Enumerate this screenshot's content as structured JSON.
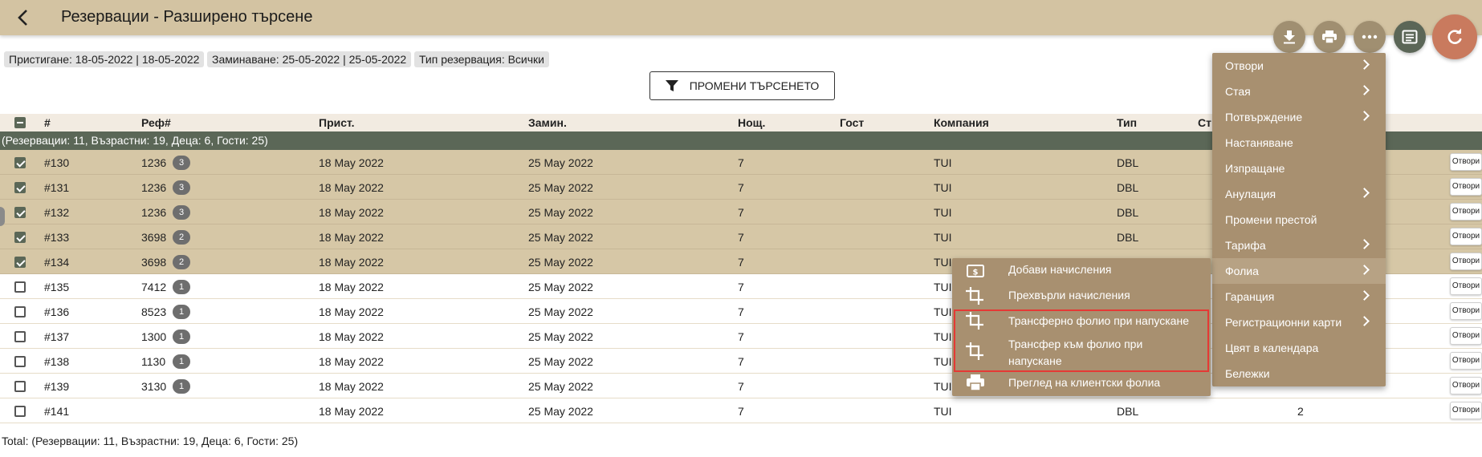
{
  "header": {
    "title": "Резервации - Разширено търсене",
    "back_icon": "chevron-left-icon",
    "actions": [
      "download-icon",
      "print-icon",
      "more-horiz-icon",
      "list-view-icon",
      "refresh-icon"
    ],
    "colors": {
      "header_bg": "#d3c3a2",
      "menu_bg": "#a89070",
      "summary_bg": "#5b6757",
      "refresh_fab": "#c97a5e"
    }
  },
  "filters": {
    "arrival": "Пристигане: 18-05-2022 | 18-05-2022",
    "departure": "Заминаване: 25-05-2022 | 25-05-2022",
    "type": "Тип резервация: Всички"
  },
  "search_button": {
    "label": "ПРОМЕНИ ТЪРСЕНЕТО",
    "icon": "filter-icon"
  },
  "table": {
    "columns": {
      "num": "#",
      "ref": "Реф#",
      "arrival": "Прист.",
      "departure": "Замин.",
      "nights": "Нощ.",
      "guest": "Гост",
      "company": "Компания",
      "type": "Тип",
      "status": "Ст"
    },
    "summary": "(Резервации: 11, Възрастни: 19, Деца: 6, Гости: 25)",
    "open_label": "Отвори",
    "rows": [
      {
        "num": "#130",
        "ref": "1236",
        "badge": "3",
        "arrival": "18 May 2022",
        "departure": "25 May 2022",
        "nights": "7",
        "company": "TUI",
        "type": "DBL",
        "last": "",
        "selected": true
      },
      {
        "num": "#131",
        "ref": "1236",
        "badge": "3",
        "arrival": "18 May 2022",
        "departure": "25 May 2022",
        "nights": "7",
        "company": "TUI",
        "type": "DBL",
        "last": "",
        "selected": true
      },
      {
        "num": "#132",
        "ref": "1236",
        "badge": "3",
        "arrival": "18 May 2022",
        "departure": "25 May 2022",
        "nights": "7",
        "company": "TUI",
        "type": "DBL",
        "last": "",
        "selected": true
      },
      {
        "num": "#133",
        "ref": "3698",
        "badge": "2",
        "arrival": "18 May 2022",
        "departure": "25 May 2022",
        "nights": "7",
        "company": "TUI",
        "type": "DBL",
        "last": "",
        "selected": true
      },
      {
        "num": "#134",
        "ref": "3698",
        "badge": "2",
        "arrival": "18 May 2022",
        "departure": "25 May 2022",
        "nights": "7",
        "company": "TUI",
        "type": "",
        "last": "",
        "selected": true
      },
      {
        "num": "#135",
        "ref": "7412",
        "badge": "1",
        "arrival": "18 May 2022",
        "departure": "25 May 2022",
        "nights": "7",
        "company": "TUI",
        "type": "",
        "last": "",
        "selected": false
      },
      {
        "num": "#136",
        "ref": "8523",
        "badge": "1",
        "arrival": "18 May 2022",
        "departure": "25 May 2022",
        "nights": "7",
        "company": "TUI",
        "type": "",
        "last": "",
        "selected": false
      },
      {
        "num": "#137",
        "ref": "1300",
        "badge": "1",
        "arrival": "18 May 2022",
        "departure": "25 May 2022",
        "nights": "7",
        "company": "TUI",
        "type": "",
        "last": "",
        "selected": false
      },
      {
        "num": "#138",
        "ref": "1130",
        "badge": "1",
        "arrival": "18 May 2022",
        "departure": "25 May 2022",
        "nights": "7",
        "company": "TUI",
        "type": "",
        "last": "",
        "selected": false
      },
      {
        "num": "#139",
        "ref": "3130",
        "badge": "1",
        "arrival": "18 May 2022",
        "departure": "25 May 2022",
        "nights": "7",
        "company": "TUI",
        "type": "",
        "last": "",
        "selected": false
      },
      {
        "num": "#141",
        "ref": "",
        "badge": "",
        "arrival": "18 May 2022",
        "departure": "25 May 2022",
        "nights": "7",
        "company": "TUI",
        "type": "DBL",
        "last": "2",
        "selected": false
      }
    ]
  },
  "total": "Total: (Резервации: 11, Възрастни: 19, Деца: 6, Гости: 25)",
  "main_menu": [
    {
      "label": "Отвори",
      "submenu": true
    },
    {
      "label": "Стая",
      "submenu": true
    },
    {
      "label": "Потвърждение",
      "submenu": true
    },
    {
      "label": "Настаняване",
      "submenu": false
    },
    {
      "label": "Изпращане",
      "submenu": false
    },
    {
      "label": "Анулация",
      "submenu": true
    },
    {
      "label": "Промени престой",
      "submenu": false
    },
    {
      "label": "Тарифа",
      "submenu": true
    },
    {
      "label": "Фолиа",
      "submenu": true,
      "active": true
    },
    {
      "label": "Гаранция",
      "submenu": true
    },
    {
      "label": "Регистрационни карти",
      "submenu": true
    },
    {
      "label": "Цвят в календара",
      "submenu": false
    },
    {
      "label": "Бележки",
      "submenu": false
    }
  ],
  "folio_menu": [
    {
      "label": "Добави начисления",
      "icon": "money-icon"
    },
    {
      "label": "Прехвърли начисления",
      "icon": "crop-icon"
    },
    {
      "label": "Трансферно фолио при напускане",
      "icon": "crop-icon"
    },
    {
      "label": "Трансфер към фолио при напускане",
      "icon": "crop-icon"
    },
    {
      "label": "Преглед на клиентски фолиа",
      "icon": "print-icon"
    }
  ]
}
